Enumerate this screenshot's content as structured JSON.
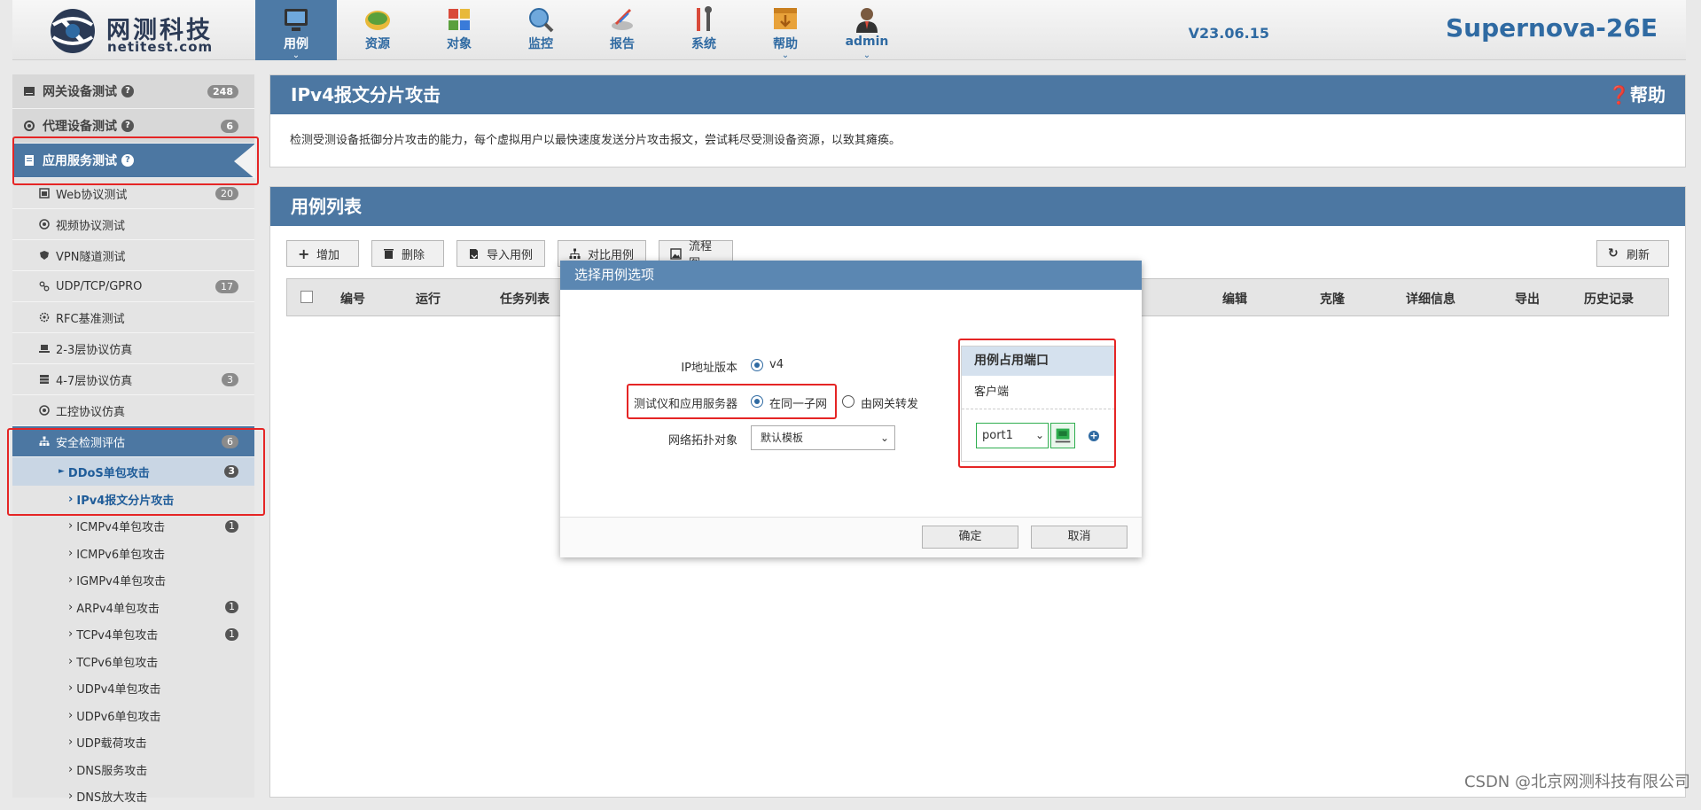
{
  "header": {
    "logo_cn": "网测科技",
    "logo_en": "netitest.com",
    "nav": [
      {
        "label": "用例",
        "icon": "monitor-icon",
        "active": true,
        "caret": true
      },
      {
        "label": "资源",
        "icon": "resource-icon",
        "active": false,
        "caret": false
      },
      {
        "label": "对象",
        "icon": "object-icon",
        "active": false,
        "caret": false
      },
      {
        "label": "监控",
        "icon": "monitor-globe-icon",
        "active": false,
        "caret": false
      },
      {
        "label": "报告",
        "icon": "report-icon",
        "active": false,
        "caret": false
      },
      {
        "label": "系统",
        "icon": "tools-icon",
        "active": false,
        "caret": false
      },
      {
        "label": "帮助",
        "icon": "help-box-icon",
        "active": false,
        "caret": true
      },
      {
        "label": "admin",
        "icon": "user-icon",
        "active": false,
        "caret": true
      }
    ],
    "version": "V23.06.15",
    "product": "Supernova-26E"
  },
  "sidebar": {
    "groups": [
      {
        "label": "网关设备测试",
        "badge": "248"
      },
      {
        "label": "代理设备测试",
        "badge": "6"
      },
      {
        "label": "应用服务测试",
        "badge": ""
      }
    ],
    "items": [
      {
        "label": "Web协议测试",
        "badge": "20"
      },
      {
        "label": "视频协议测试",
        "badge": ""
      },
      {
        "label": "VPN隧道测试",
        "badge": ""
      },
      {
        "label": "UDP/TCP/GPRO",
        "badge": "17"
      },
      {
        "label": "RFC基准测试",
        "badge": ""
      },
      {
        "label": "2-3层协议仿真",
        "badge": ""
      },
      {
        "label": "4-7层协议仿真",
        "badge": "3"
      },
      {
        "label": "工控协议仿真",
        "badge": ""
      },
      {
        "label": "安全检测评估",
        "badge": "6"
      }
    ],
    "sub": {
      "label": "DDoS单包攻击",
      "badge": "3"
    },
    "leaves": [
      {
        "label": "IPv4报文分片攻击",
        "badge": ""
      },
      {
        "label": "ICMPv4单包攻击",
        "badge": "1"
      },
      {
        "label": "ICMPv6单包攻击",
        "badge": ""
      },
      {
        "label": "IGMPv4单包攻击",
        "badge": ""
      },
      {
        "label": "ARPv4单包攻击",
        "badge": "1"
      },
      {
        "label": "TCPv4单包攻击",
        "badge": "1"
      },
      {
        "label": "TCPv6单包攻击",
        "badge": ""
      },
      {
        "label": "UDPv4单包攻击",
        "badge": ""
      },
      {
        "label": "UDPv6单包攻击",
        "badge": ""
      },
      {
        "label": "UDP载荷攻击",
        "badge": ""
      },
      {
        "label": "DNS服务攻击",
        "badge": ""
      },
      {
        "label": "DNS放大攻击",
        "badge": ""
      }
    ]
  },
  "info_panel": {
    "title": "IPv4报文分片攻击",
    "help": "帮助",
    "description": "检测受测设备抵御分片攻击的能力，每个虚拟用户以最快速度发送分片攻击报文，尝试耗尽受测设备资源，以致其瘫痪。"
  },
  "list_panel": {
    "title": "用例列表",
    "buttons": {
      "add": "增加",
      "delete": "删除",
      "import": "导入用例",
      "compare": "对比用例",
      "flow": "流程图",
      "refresh": "刷新"
    },
    "columns": {
      "number": "编号",
      "run": "运行",
      "tasks": "任务列表",
      "edit": "编辑",
      "clone": "克隆",
      "details": "详细信息",
      "export": "导出",
      "history": "历史记录"
    }
  },
  "modal": {
    "title": "选择用例选项",
    "ip_label": "IP地址版本",
    "ip_option": "v4",
    "tester_label": "测试仪和应用服务器",
    "option_same_subnet": "在同一子网",
    "option_gateway": "由网关转发",
    "topo_label": "网络拓扑对象",
    "topo_value": "默认模板",
    "ports_title": "用例占用端口",
    "client_label": "客户端",
    "port_value": "port1",
    "confirm": "确定",
    "cancel": "取消"
  },
  "watermark": "CSDN @北京网测科技有限公司",
  "colors": {
    "accent": "#4c77a2",
    "highlight_red": "#e52525",
    "port_green": "#2fae4f"
  }
}
